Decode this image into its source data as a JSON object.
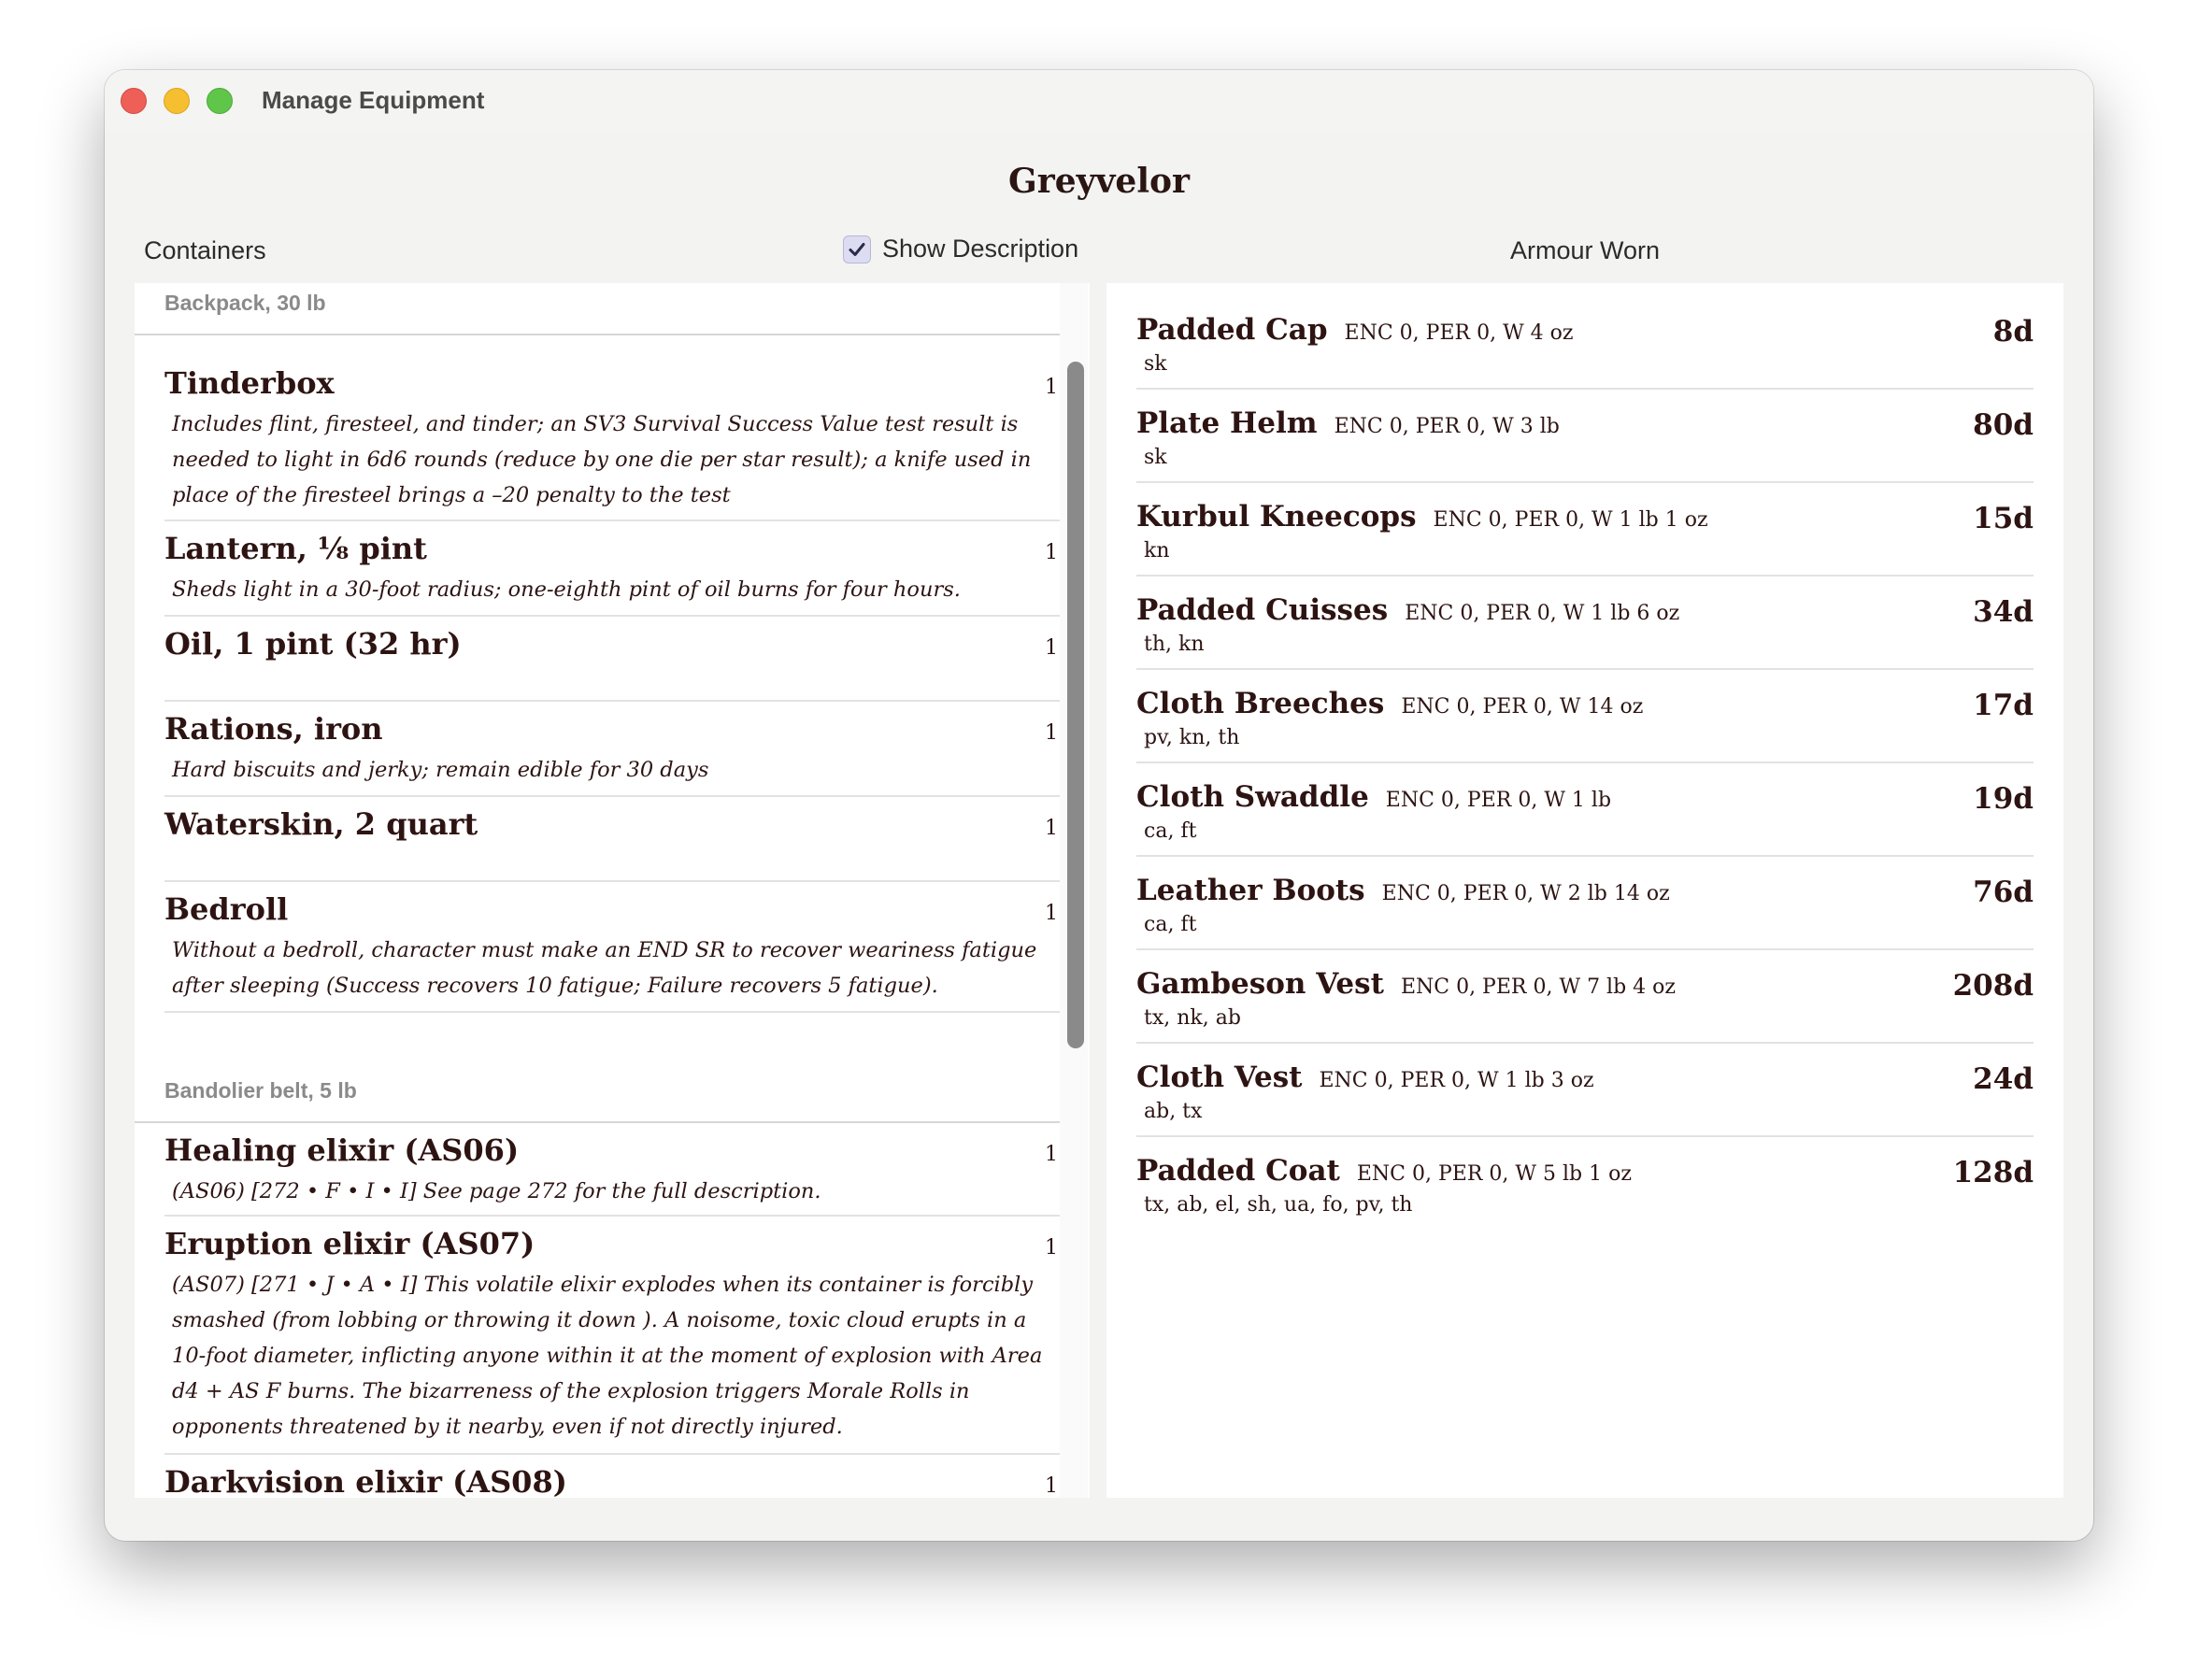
{
  "window": {
    "title": "Manage Equipment"
  },
  "character": {
    "name": "Greyvelor"
  },
  "headers": {
    "containers": "Containers",
    "show_description": "Show Description",
    "armour_worn": "Armour Worn"
  },
  "show_description_checked": true,
  "containers": [
    {
      "label": "Backpack, 30 lb",
      "items": [
        {
          "name": "Tinderbox",
          "qty": "1",
          "desc": "Includes flint, firesteel, and tinder; an SV3 Survival Success Value test result is needed to light in 6d6 rounds (reduce by one die per star result); a knife used in place of the firesteel brings a –20 penalty to the test"
        },
        {
          "name": "Lantern, ⅛ pint",
          "qty": "1",
          "desc": "Sheds light in a 30-foot radius; one-eighth pint of oil burns for four hours."
        },
        {
          "name": "Oil, 1 pint (32 hr)",
          "qty": "1",
          "desc": ""
        },
        {
          "name": "Rations, iron",
          "qty": "1",
          "desc": "Hard biscuits and jerky; remain edible for 30 days"
        },
        {
          "name": "Waterskin, 2 quart",
          "qty": "1",
          "desc": ""
        },
        {
          "name": "Bedroll",
          "qty": "1",
          "desc": "Without a bedroll, character must make an END SR to recover weariness fatigue after sleeping (Success recovers 10 fatigue; Failure recovers 5 fatigue)."
        }
      ]
    },
    {
      "label": "Bandolier belt, 5 lb",
      "items": [
        {
          "name": "Healing elixir (AS06)",
          "qty": "1",
          "desc": "(AS06) [272 • F • I • I] See page 272 for the full description."
        },
        {
          "name": "Eruption elixir (AS07)",
          "qty": "1",
          "desc": "(AS07) [271 • J • A • I] This volatile elixir explodes when its container is forcibly smashed (from lobbing or throwing it down ). A noisome, toxic cloud erupts in a 10-foot diameter, inflicting anyone within it at the moment of explosion with Area d4 + AS F burns. The bizarreness of the explosion triggers Morale Rolls in opponents threatened by it nearby, even if not directly injured."
        },
        {
          "name": "Darkvision elixir (AS08)",
          "qty": "1",
          "desc": ""
        }
      ]
    }
  ],
  "armour": [
    {
      "name": "Padded Cap",
      "stats": "ENC 0, PER 0, W  4 oz",
      "price": "8d",
      "locations": "sk"
    },
    {
      "name": "Plate Helm",
      "stats": "ENC 0, PER 0, W 3 lb",
      "price": "80d",
      "locations": "sk"
    },
    {
      "name": "Kurbul Kneecops",
      "stats": "ENC 0, PER 0, W 1 lb 1 oz",
      "price": "15d",
      "locations": "kn"
    },
    {
      "name": "Padded Cuisses",
      "stats": "ENC 0, PER 0, W 1 lb 6 oz",
      "price": "34d",
      "locations": "th, kn"
    },
    {
      "name": "Cloth Breeches",
      "stats": "ENC 0, PER 0, W  14 oz",
      "price": "17d",
      "locations": "pv, kn, th"
    },
    {
      "name": "Cloth Swaddle",
      "stats": "ENC 0, PER 0, W 1 lb",
      "price": "19d",
      "locations": "ca, ft"
    },
    {
      "name": "Leather Boots",
      "stats": "ENC 0, PER 0, W 2 lb 14 oz",
      "price": "76d",
      "locations": "ca, ft"
    },
    {
      "name": "Gambeson Vest",
      "stats": "ENC 0, PER 0, W 7 lb 4 oz",
      "price": "208d",
      "locations": "tx, nk, ab"
    },
    {
      "name": "Cloth Vest",
      "stats": "ENC 0, PER 0, W 1 lb 3 oz",
      "price": "24d",
      "locations": "ab, tx"
    },
    {
      "name": "Padded Coat",
      "stats": "ENC 0, PER 0, W 5 lb 1 oz",
      "price": "128d",
      "locations": "tx, ab, el, sh, ua, fo, pv, th"
    }
  ]
}
